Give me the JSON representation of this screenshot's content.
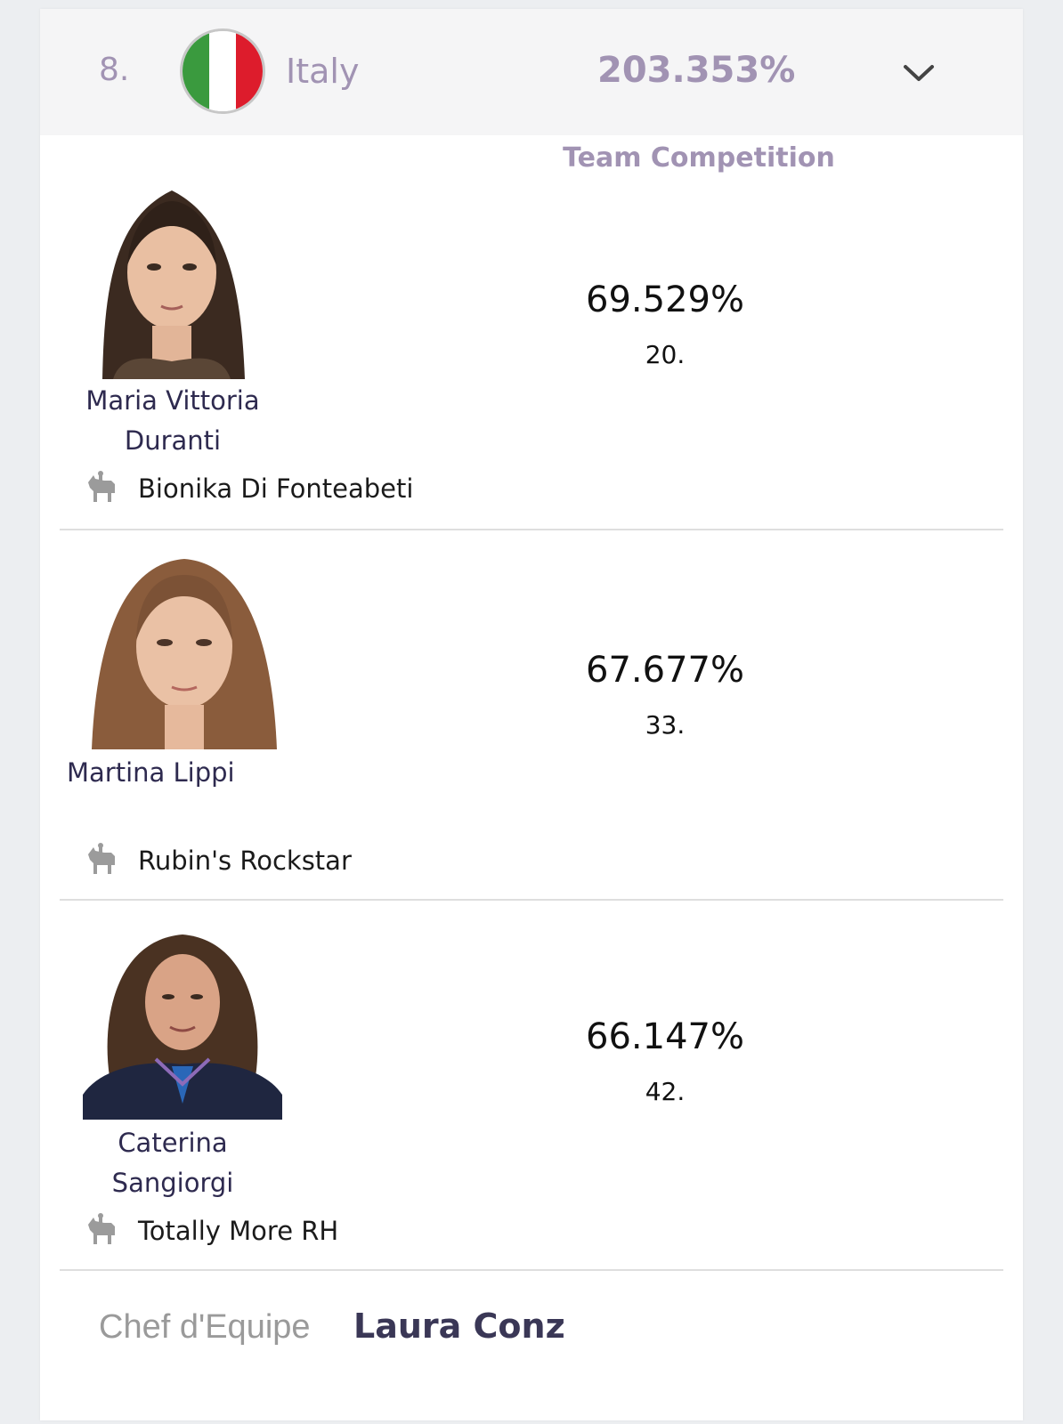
{
  "team": {
    "rank": "8.",
    "country": "Italy",
    "score": "203.353%",
    "flag_colors": [
      "#3a9a3e",
      "#ffffff",
      "#dd1c2c"
    ],
    "expand_icon": "chevron-down-icon"
  },
  "section_title": "Team Competition",
  "riders": [
    {
      "name_line1": "Maria Vittoria",
      "name_line2": "Duranti",
      "horse": "Bionika Di Fonteabeti",
      "score": "69.529%",
      "rank": "20."
    },
    {
      "name_line1": "Martina Lippi",
      "name_line2": "",
      "horse": "Rubin's Rockstar",
      "score": "67.677%",
      "rank": "33."
    },
    {
      "name_line1": "Caterina",
      "name_line2": "Sangiorgi",
      "horse": "Totally More RH",
      "score": "66.147%",
      "rank": "42."
    }
  ],
  "chef": {
    "label": "Chef d'Equipe",
    "name": "Laura Conz"
  },
  "colors": {
    "accent": "#a193b3",
    "name_text": "#2e2a4f"
  },
  "icons": {
    "horse": "horse-rider-icon"
  }
}
